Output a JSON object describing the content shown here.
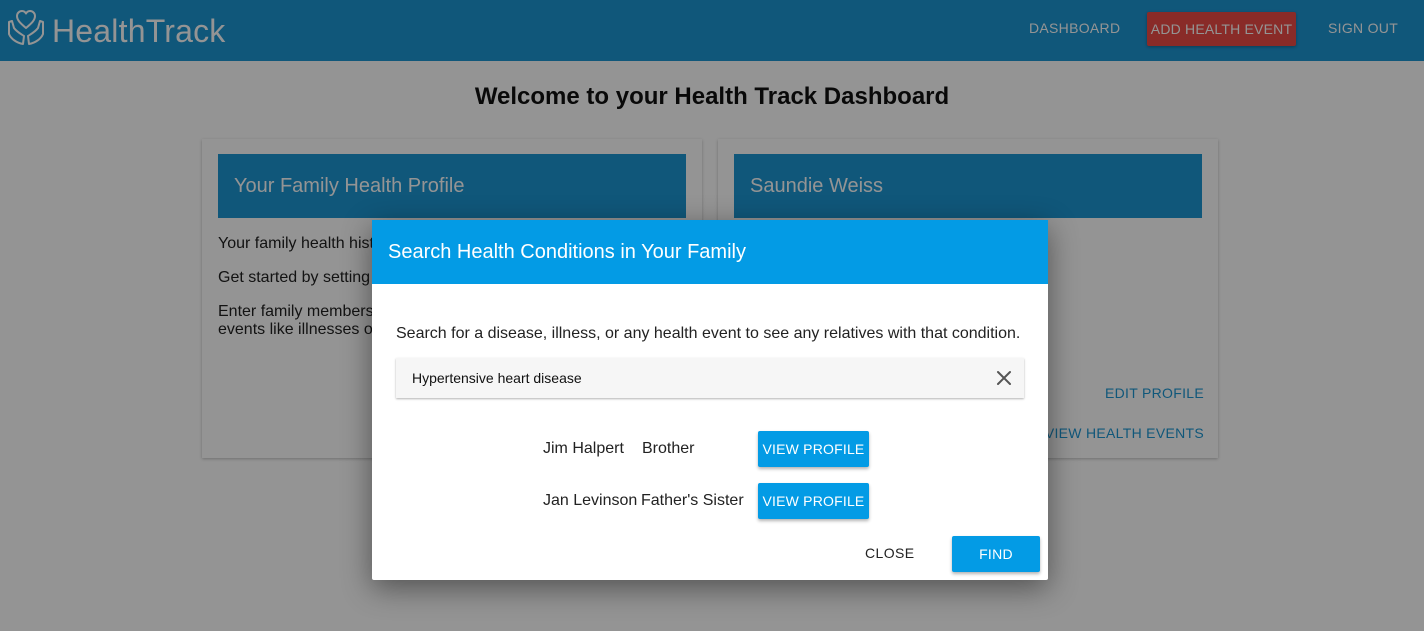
{
  "brand": {
    "name": "HealthTrack",
    "logo_icon": "hands-heart-icon"
  },
  "nav": {
    "dashboard": "DASHBOARD",
    "add_event": "ADD HEALTH EVENT",
    "sign_out": "SIGN OUT"
  },
  "page": {
    "title": "Welcome to your Health Track Dashboard"
  },
  "cards": {
    "left": {
      "header": "Your Family Health Profile",
      "line1": "Your family health hist",
      "line2": "Get started by setting",
      "line3": "Enter family members",
      "line3b": "events like illnesses o"
    },
    "right": {
      "header": "Saundie Weiss",
      "edit_profile": "EDIT PROFILE",
      "view_events": "VIEW HEALTH EVENTS"
    }
  },
  "dialog": {
    "title": "Search Health Conditions in Your Family",
    "description": "Search for a disease, illness, or any health event to see any relatives with that condition.",
    "search_value": "Hypertensive heart disease",
    "clear_icon": "close-icon",
    "results": [
      {
        "name": "Jim Halpert",
        "relation": "Brother",
        "button": "VIEW PROFILE"
      },
      {
        "name": "Jan Levinson",
        "relation": "Father's Sister",
        "button": "VIEW PROFILE"
      }
    ],
    "close_label": "CLOSE",
    "find_label": "FIND"
  },
  "colors": {
    "nav_blue": "#1d96d3",
    "dialog_blue": "#039be5",
    "add_button_red": "#ec4a45",
    "overlay": "rgba(0,0,0,0.42)"
  }
}
